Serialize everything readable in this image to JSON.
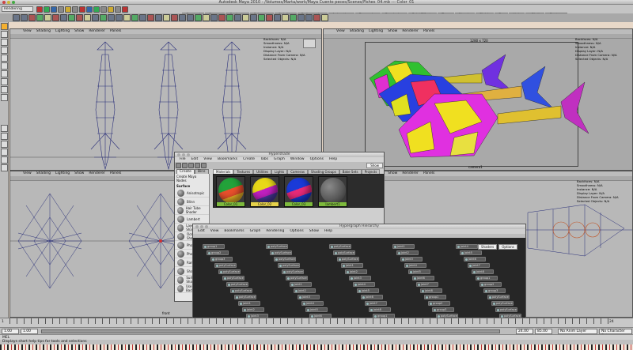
{
  "window": {
    "title": "Autodesk Maya 2010 - /Volumes/Marta/work/Maya Cuento peces/Scenes/Fishes_04.mb --- Color_01"
  },
  "status_line": {
    "mode": "Rendering"
  },
  "shelf_tabs": [
    "General",
    "Curves",
    "Surfaces",
    "Polygons",
    "Subdivs",
    "Deformation",
    "Animation",
    "Dynamics",
    "Rendering",
    "PaintEffects",
    "Toon",
    "Muscle",
    "Fluids",
    "Fur",
    "Hair",
    "nCloth",
    "Custom"
  ],
  "viewport_menu": [
    "View",
    "Shading",
    "Lighting",
    "Show",
    "Renderer",
    "Panels"
  ],
  "viewports": {
    "top_left": {
      "camera": ""
    },
    "top_right": {
      "camera": "camera1",
      "resolution": "1280 x 720"
    },
    "bottom_left": {
      "camera": "front"
    },
    "bottom_right": {
      "camera": ""
    }
  },
  "hud": {
    "keys": [
      "Backfaces:",
      "Smoothness:",
      "Instance:",
      "Display Layer:",
      "Distance From Camera:",
      "Selected Objects:"
    ],
    "values": [
      "N/A",
      "N/A",
      "N/A",
      "N/A",
      "N/A",
      "N/A"
    ]
  },
  "hypershade": {
    "title": "Hypershade",
    "menu": [
      "File",
      "Edit",
      "View",
      "Bookmarks",
      "Create",
      "Tabs",
      "Graph",
      "Window",
      "Options",
      "Help"
    ],
    "search_label": "Show",
    "left_tabs": [
      "Create",
      "Bins"
    ],
    "create_header": "Create Maya Nodes",
    "surface_header": "Surface",
    "nodes": [
      "Anisotropic",
      "Blinn",
      "Hair Tube Shader",
      "Lambert",
      "Layered Shader",
      "Ocean Shader",
      "Phong",
      "Phong E",
      "Ramp Shader",
      "Shading Map",
      "Surface Shader",
      "Use Background"
    ],
    "mat_tabs": [
      "Materials",
      "Textures",
      "Utilities",
      "Lights",
      "Cameras",
      "Shading Groups",
      "Bake Sets",
      "Projects"
    ],
    "swatches": [
      {
        "label": "Color_01",
        "colors": [
          "#23a23a",
          "#e8502c",
          "#f0b828"
        ]
      },
      {
        "label": "Color_02",
        "colors": [
          "#e8d818",
          "#c020c0",
          "#4a3aa0"
        ]
      },
      {
        "label": "Color_03",
        "colors": [
          "#1a3ad8",
          "#e82a78",
          "#1a3ad8"
        ]
      },
      {
        "label": "lambert1",
        "colors": [
          "#8a8a8a",
          "#5a5a5a",
          "#2a2a2a"
        ]
      }
    ]
  },
  "hypergraph": {
    "title": "Hypergraph Hierarchy",
    "menu": [
      "Edit",
      "View",
      "Bookmarks",
      "Graph",
      "Rendering",
      "Options",
      "Show",
      "Help"
    ],
    "buttons": [
      "Shaders",
      "Options"
    ],
    "node_labels": [
      "group1",
      "group2",
      "group3",
      "polySurface1",
      "polySurface2",
      "polySurface3",
      "polySurface4",
      "polySurface5",
      "polySurface6",
      "joint1",
      "joint2",
      "joint3",
      "joint4",
      "joint5",
      "joint6",
      "joint7",
      "joint8"
    ]
  },
  "timeline": {
    "start_label": "1",
    "end_label": "24",
    "range_start": "1.00",
    "range_min": "1.00",
    "range_end": "24.00",
    "range_max": "85.00",
    "anim_layer": "No Anim Layer",
    "char_set": "No Character Set"
  },
  "mel": {
    "label": "MEL",
    "help": "Displays short help tips for tools and selections"
  }
}
